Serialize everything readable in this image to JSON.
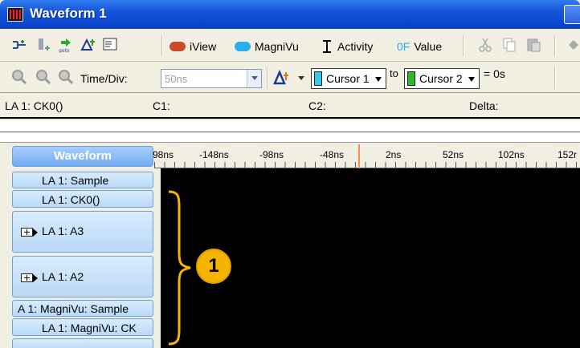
{
  "window": {
    "title": "Waveform 1"
  },
  "toolbar1": {
    "iview_label": "iView",
    "magnivu_label": "MagniVu",
    "activity_label": "Activity",
    "value_prefix": "0F",
    "value_label": "Value",
    "iview_color": "#c84a2a",
    "magnivu_color": "#2ab0e8"
  },
  "toolbar2": {
    "timediv_label": "Time/Div:",
    "timediv_value": "50ns",
    "cursor1_label": "Cursor 1",
    "cursor1_color": "#39c6e8",
    "to_label": "to",
    "cursor2_label": "Cursor 2",
    "cursor2_color": "#2db82d",
    "delta_result": "= 0s"
  },
  "info": {
    "signal": "LA 1: CK0()",
    "c1": "C1:",
    "c2": "C2:",
    "delta": "Delta:"
  },
  "timeline": {
    "tab_label": "Waveform",
    "ticks": [
      "98ns",
      "-148ns",
      "-98ns",
      "-48ns",
      "2ns",
      "52ns",
      "102ns",
      "152r"
    ]
  },
  "signals": [
    {
      "label": "LA 1: Sample"
    },
    {
      "label": "LA 1: CK0()"
    },
    {
      "label": "LA 1: A3"
    },
    {
      "label": "LA 1: A2"
    },
    {
      "label": "A 1: MagniVu: Sample"
    },
    {
      "label": "LA 1: MagniVu: CK"
    }
  ],
  "callout": {
    "number": "1"
  }
}
